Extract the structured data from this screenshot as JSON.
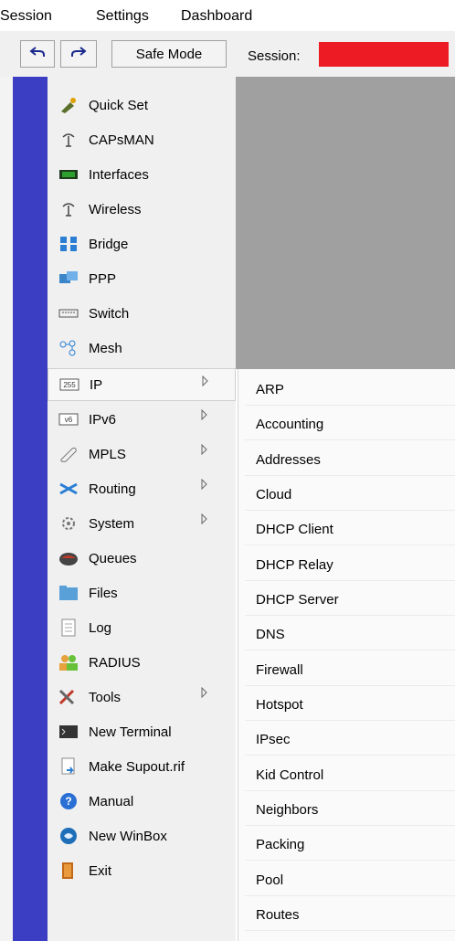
{
  "menubar": {
    "items": [
      "Session",
      "Settings",
      "Dashboard"
    ]
  },
  "toolbar": {
    "undo_icon": "undo-icon",
    "redo_icon": "redo-icon",
    "safe_mode_label": "Safe Mode",
    "session_label": "Session:",
    "session_value_color": "#ed1c24"
  },
  "menu": {
    "items": [
      {
        "label": "Quick Set",
        "icon": "quick-set-icon",
        "submenu": false
      },
      {
        "label": "CAPsMAN",
        "icon": "antenna-icon",
        "submenu": false
      },
      {
        "label": "Interfaces",
        "icon": "interfaces-icon",
        "submenu": false
      },
      {
        "label": "Wireless",
        "icon": "antenna-icon",
        "submenu": false
      },
      {
        "label": "Bridge",
        "icon": "bridge-icon",
        "submenu": false
      },
      {
        "label": "PPP",
        "icon": "ppp-icon",
        "submenu": false
      },
      {
        "label": "Switch",
        "icon": "switch-icon",
        "submenu": false
      },
      {
        "label": "Mesh",
        "icon": "mesh-icon",
        "submenu": false
      },
      {
        "label": "IP",
        "icon": "ip-icon",
        "submenu": true
      },
      {
        "label": "IPv6",
        "icon": "ipv6-icon",
        "submenu": true
      },
      {
        "label": "MPLS",
        "icon": "mpls-icon",
        "submenu": true
      },
      {
        "label": "Routing",
        "icon": "routing-icon",
        "submenu": true
      },
      {
        "label": "System",
        "icon": "gear-icon",
        "submenu": true
      },
      {
        "label": "Queues",
        "icon": "queues-icon",
        "submenu": false
      },
      {
        "label": "Files",
        "icon": "folder-icon",
        "submenu": false
      },
      {
        "label": "Log",
        "icon": "log-icon",
        "submenu": false
      },
      {
        "label": "RADIUS",
        "icon": "users-icon",
        "submenu": false
      },
      {
        "label": "Tools",
        "icon": "tools-icon",
        "submenu": true
      },
      {
        "label": "New Terminal",
        "icon": "terminal-icon",
        "submenu": false
      },
      {
        "label": "Make Supout.rif",
        "icon": "file-export-icon",
        "submenu": false
      },
      {
        "label": "Manual",
        "icon": "help-icon",
        "submenu": false
      },
      {
        "label": "New WinBox",
        "icon": "winbox-icon",
        "submenu": false
      },
      {
        "label": "Exit",
        "icon": "exit-icon",
        "submenu": false
      }
    ],
    "selected": "IP"
  },
  "ip_submenu": {
    "items": [
      "ARP",
      "Accounting",
      "Addresses",
      "Cloud",
      "DHCP Client",
      "DHCP Relay",
      "DHCP Server",
      "DNS",
      "Firewall",
      "Hotspot",
      "IPsec",
      "Kid Control",
      "Neighbors",
      "Packing",
      "Pool",
      "Routes"
    ]
  },
  "colors": {
    "accent_strip": "#3b3dc2",
    "workspace_gray": "#a0a0a0",
    "panel_bg": "#f0f0f0"
  }
}
